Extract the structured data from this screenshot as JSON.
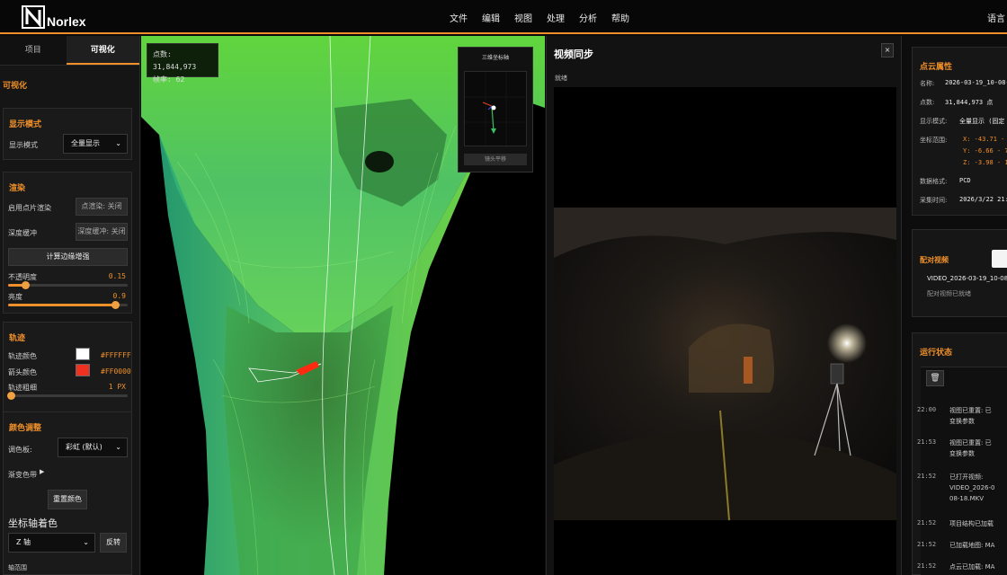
{
  "app": {
    "logo_letter": "N",
    "logo_text": "Norlex",
    "language": "语言"
  },
  "menu": [
    "文件",
    "编辑",
    "视图",
    "处理",
    "分析",
    "帮助"
  ],
  "left": {
    "tabs": [
      "项目",
      "可视化"
    ],
    "heading": "可视化",
    "display": {
      "title": "显示模式",
      "label": "显示模式",
      "value": "全量显示"
    },
    "render": {
      "title": "渲染",
      "point_render_label": "启用点片渲染",
      "point_render_btn": "点渲染: 关闭",
      "depth_label": "深度缓冲",
      "depth_btn": "深度缓冲: 关闭",
      "edge_btn": "计算边缘增强",
      "opacity_label": "不透明度",
      "opacity_value": "0.15",
      "opacity": 0.15,
      "brightness_label": "亮度",
      "brightness_value": "0.9",
      "brightness": 0.9
    },
    "track": {
      "title": "轨迹",
      "color_label": "轨迹颜色",
      "color_value": "#FFFFFF",
      "arrow_label": "箭头颜色",
      "arrow_value": "#FF0000",
      "width_label": "轨迹粗细",
      "width_value": "1 PX"
    },
    "color": {
      "title": "颜色调整",
      "palette_label": "调色板:",
      "palette_value": "彩虹 (默认)",
      "gradient_label": "渐变色带",
      "reset_btn": "重置颜色",
      "axis_title": "坐标轴着色",
      "axis_value": "Z 轴",
      "invert_btn": "反转",
      "range_label": "轴范围"
    }
  },
  "viewport": {
    "points_label": "点数:",
    "points_value": "31,844,973",
    "fps_label": "帧率:",
    "fps_value": "62",
    "axis_title": "三维坐标轴",
    "axis_reset": "镜头平移"
  },
  "video": {
    "title": "视频同步",
    "close": "×",
    "status": "就绪"
  },
  "right": {
    "props_title": "点云属性",
    "name_label": "名称:",
    "name_value": "2026-03-19_10-08-",
    "count_label": "点数:",
    "count_value": "31,844,973 点",
    "mode_label": "显示模式:",
    "mode_value": "全量显示 (固定",
    "range_label": "坐标范围:",
    "range_x": "X: -43.71 - 4",
    "range_y": "Y: -6.66 - 7",
    "range_z": "Z: -3.98 - 1",
    "format_label": "数据格式:",
    "format_value": "PCD",
    "time_label": "采集时间:",
    "time_value": "2026/3/22 21:",
    "video_title": "配对视频",
    "video_file": "VIDEO_2026-03-19_10-08-18.M",
    "video_status": "配对视频已就绪",
    "run_title": "运行状态",
    "logs": [
      {
        "time": "22:00",
        "l1": "视图已重置: 已",
        "l2": "变换参数"
      },
      {
        "time": "21:53",
        "l1": "视图已重置: 已",
        "l2": "变换参数"
      },
      {
        "time": "21:52",
        "l1": "已打开视频:",
        "l2": "VIDEO_2026-0",
        "l3": "08-18.MKV"
      },
      {
        "time": "21:52",
        "l1": "项目结构已加载"
      },
      {
        "time": "21:52",
        "l1": "已加载地图: MA"
      },
      {
        "time": "21:52",
        "l1": "点云已加载: MA"
      }
    ]
  },
  "colors": {
    "accent": "#f0902a",
    "track": "#FFFFFF",
    "arrow": "#FF0000"
  },
  "icons": [
    "logo-icon",
    "chevron-down-icon",
    "trash-icon",
    "play-triangle-icon",
    "close-icon"
  ]
}
